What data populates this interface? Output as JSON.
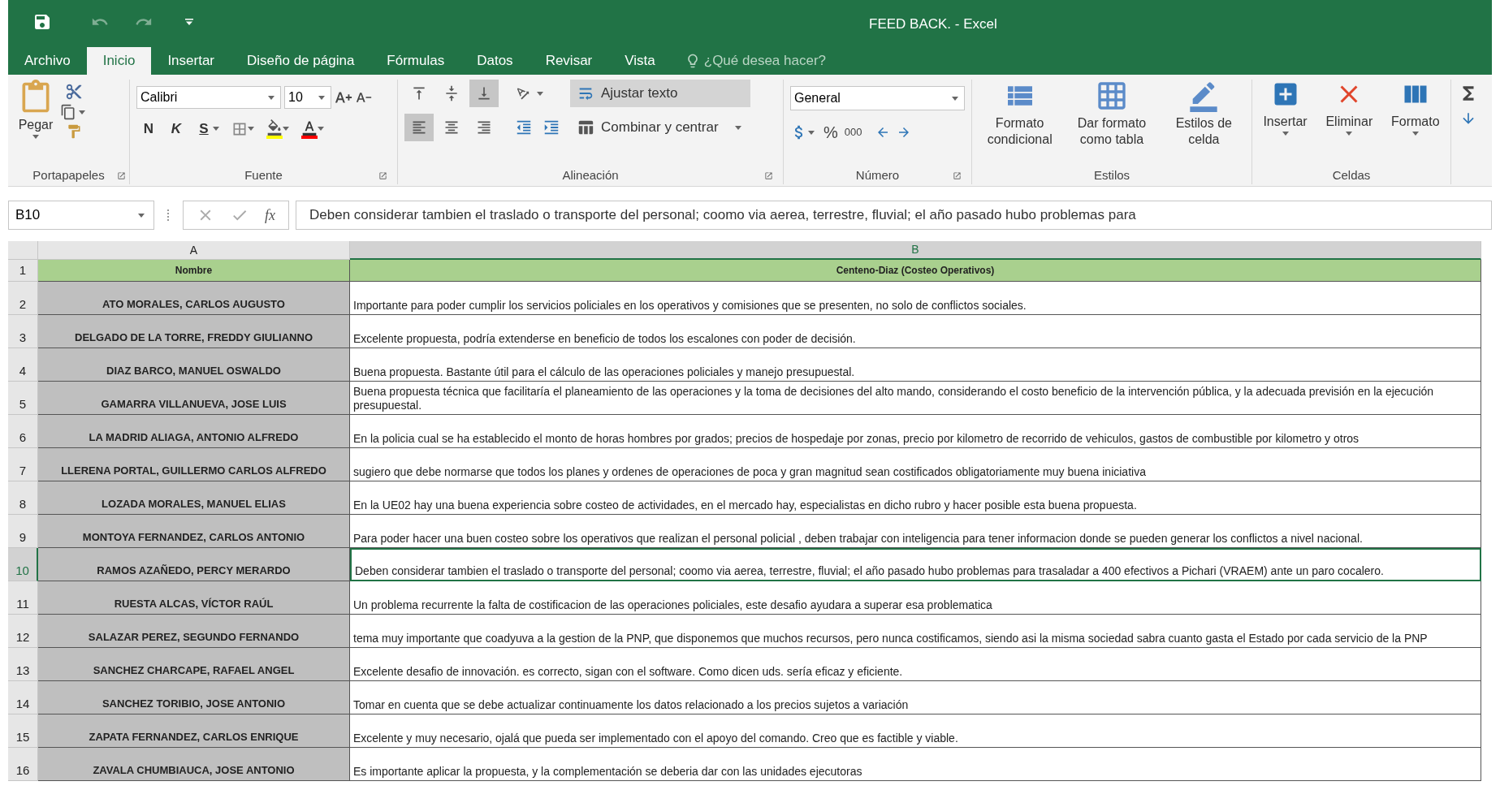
{
  "title_bar": {
    "title": "FEED BACK. - Excel"
  },
  "tabs": [
    {
      "label": "Archivo",
      "selected": false
    },
    {
      "label": "Inicio",
      "selected": true
    },
    {
      "label": "Insertar",
      "selected": false
    },
    {
      "label": "Diseño de página",
      "selected": false
    },
    {
      "label": "Fórmulas",
      "selected": false
    },
    {
      "label": "Datos",
      "selected": false
    },
    {
      "label": "Revisar",
      "selected": false
    },
    {
      "label": "Vista",
      "selected": false
    }
  ],
  "tell_me": {
    "placeholder": "¿Qué desea hacer?"
  },
  "ribbon": {
    "clipboard": {
      "group_label": "Portapapeles",
      "paste": "Pegar"
    },
    "font": {
      "group_label": "Fuente",
      "font_name": "Calibri",
      "font_size": "10",
      "bold": "N",
      "italic": "K",
      "underline": "S"
    },
    "alignment": {
      "group_label": "Alineación",
      "vertical": [
        {
          "selected": false
        },
        {
          "selected": false
        },
        {
          "selected": true
        }
      ],
      "horizontal": [
        {
          "selected": true
        },
        {
          "selected": false
        },
        {
          "selected": false
        }
      ],
      "wrap_text": {
        "label": "Ajustar texto",
        "on": true
      },
      "merge": "Combinar y centrar"
    },
    "number": {
      "group_label": "Número",
      "format": "General",
      "percent": "%",
      "thousands": "000"
    },
    "styles": {
      "group_label": "Estilos",
      "buttons": [
        "Formato condicional",
        "Dar formato como tabla",
        "Estilos de celda"
      ]
    },
    "cells": {
      "group_label": "Celdas",
      "buttons": [
        "Insertar",
        "Eliminar",
        "Formato"
      ]
    }
  },
  "formula_bar": {
    "name_box": "B10",
    "function_label": "fx",
    "formula": "Deben considerar tambien el traslado o transporte del personal; coomo via aerea, terrestre, fluvial; el año pasado hubo problemas para"
  },
  "sheet": {
    "columns": [
      {
        "label": "A",
        "selected": false
      },
      {
        "label": "B",
        "selected": true
      }
    ],
    "header_row": {
      "number": "1",
      "cells": [
        "Nombre",
        "Centeno-Diaz (Costeo Operativos)"
      ]
    },
    "rows": [
      {
        "number": "2",
        "name": "ATO MORALES, CARLOS AUGUSTO",
        "comment": "Importante para poder cumplir los servicios policiales en los operativos y comisiones que se presenten, no solo de conflictos sociales.",
        "selected": false
      },
      {
        "number": "3",
        "name": "DELGADO DE LA TORRE, FREDDY GIULIANNO",
        "comment": "Excelente propuesta, podría extenderse en beneficio de todos los escalones con poder de decisión.",
        "selected": false
      },
      {
        "number": "4",
        "name": "DIAZ BARCO, MANUEL OSWALDO",
        "comment": "Buena propuesta. Bastante útil para el cálculo de las operaciones policiales y manejo presupuestal.",
        "selected": false
      },
      {
        "number": "5",
        "name": "GAMARRA VILLANUEVA, JOSE LUIS",
        "comment": "Buena propuesta técnica que facilitaría el planeamiento de las operaciones y la toma de decisiones del alto mando, considerando el costo beneficio de la intervención pública, y la adecuada previsión en la ejecución presupuestal.",
        "selected": false
      },
      {
        "number": "6",
        "name": "LA MADRID ALIAGA, ANTONIO ALFREDO",
        "comment": "En la policia cual se ha establecido el monto de horas hombres por grados; precios de hospedaje por zonas, precio por kilometro de recorrido de vehiculos, gastos de combustible por kilometro y otros",
        "selected": false
      },
      {
        "number": "7",
        "name": "LLERENA PORTAL, GUILLERMO CARLOS ALFREDO",
        "comment": "sugiero que debe normarse que todos los planes y ordenes de operaciones de poca y gran magnitud sean costificados obligatoriamente muy buena iniciativa",
        "selected": false
      },
      {
        "number": "8",
        "name": "LOZADA MORALES, MANUEL ELIAS",
        "comment": "En la UE02 hay una buena experiencia sobre costeo de actividades, en el mercado hay, especialistas en dicho rubro y hacer posible esta buena propuesta.",
        "selected": false
      },
      {
        "number": "9",
        "name": "MONTOYA FERNANDEZ, CARLOS ANTONIO",
        "comment": "Para poder hacer una buen costeo sobre los operativos que realizan el personal policial , deben trabajar con inteligencia para tener informacion donde se pueden generar los conflictos a nivel nacional.",
        "selected": false
      },
      {
        "number": "10",
        "name": "RAMOS AZAÑEDO, PERCY MERARDO",
        "comment": "Deben considerar tambien el traslado o transporte del personal; coomo via aerea, terrestre, fluvial; el año pasado hubo problemas para trasaladar a 400 efectivos a Pichari (VRAEM) ante un paro cocalero.",
        "selected": true
      },
      {
        "number": "11",
        "name": "RUESTA ALCAS, VÍCTOR RAÚL",
        "comment": "Un problema recurrente la falta de costificacion de las operaciones policiales, este desafio ayudara a superar esa problematica",
        "selected": false
      },
      {
        "number": "12",
        "name": "SALAZAR PEREZ, SEGUNDO FERNANDO",
        "comment": "tema muy importante que coadyuva a la gestion de la PNP, que disponemos que muchos recursos, pero nunca costificamos, siendo asi la misma sociedad sabra cuanto gasta el Estado por cada servicio de la PNP",
        "selected": false
      },
      {
        "number": "13",
        "name": "SANCHEZ CHARCAPE, RAFAEL ANGEL",
        "comment": "Excelente desafio de innovación. es correcto, sigan con el software. Como dicen uds. sería eficaz y eficiente.",
        "selected": false
      },
      {
        "number": "14",
        "name": "SANCHEZ TORIBIO, JOSE ANTONIO",
        "comment": "Tomar en cuenta que se debe actualizar continuamente los datos relacionado a los precios sujetos a variación",
        "selected": false
      },
      {
        "number": "15",
        "name": "ZAPATA FERNANDEZ, CARLOS ENRIQUE",
        "comment": "Excelente y muy necesario, ojalá que pueda ser implementado con el apoyo del comando. Creo que es factible y viable.",
        "selected": false
      },
      {
        "number": "16",
        "name": "ZAVALA CHUMBIAUCA, JOSE ANTONIO",
        "comment": "Es importante aplicar la propuesta, y la complementación se deberia dar con las unidades ejecutoras",
        "selected": false
      }
    ]
  }
}
